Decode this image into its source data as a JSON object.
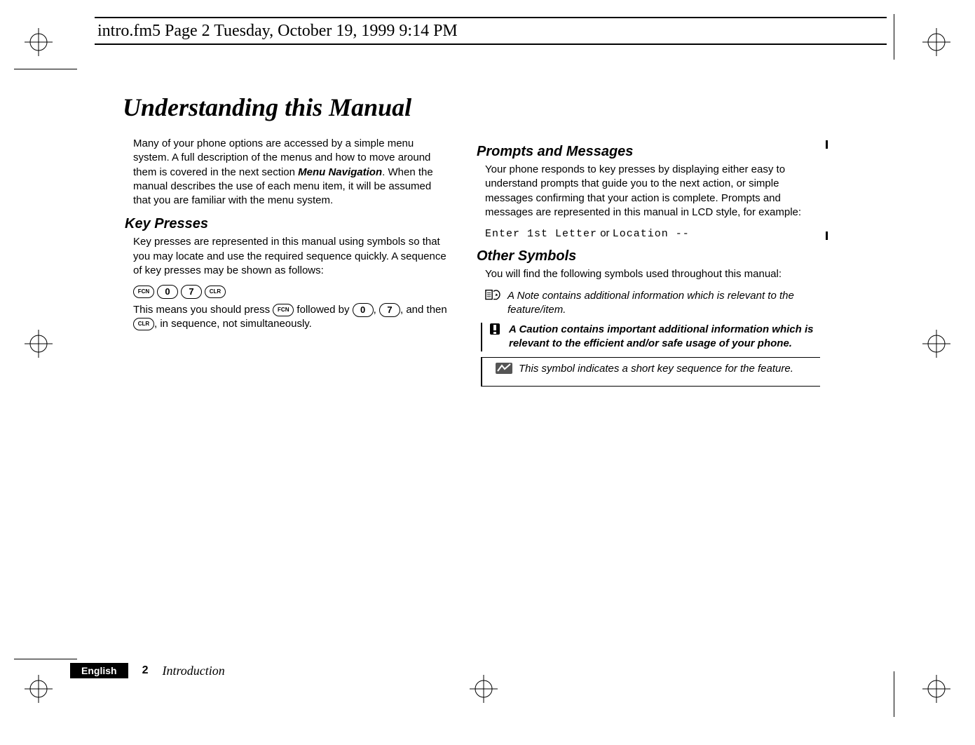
{
  "header": {
    "text": "intro.fm5  Page 2  Tuesday, October 19, 1999  9:14 PM"
  },
  "title": "Understanding this Manual",
  "left": {
    "intro_para": "Many of your phone options are accessed by a simple menu system. A full description of the menus and how to move around them is covered in the next section ",
    "intro_emph": "Menu Navigation",
    "intro_tail": ". When the manual describes the use of each menu item, it will be assumed that you are familiar with the menu system.",
    "key_presses_heading": "Key Presses",
    "kp_para1": "Key presses are represented in this manual using symbols so that you may locate and use the required sequence quickly. A sequence of key presses may be shown as follows:",
    "keys": [
      "FCN",
      "0",
      "7",
      "CLR"
    ],
    "kp_para2_a": "This means you should press ",
    "kp_para2_b": " followed by ",
    "kp_para2_c": ", ",
    "kp_para2_d": ", and then ",
    "kp_para2_e": ", in sequence, not simultaneously."
  },
  "right": {
    "prompts_heading": "Prompts and Messages",
    "prompts_para": "Your phone responds to key presses by displaying either easy to understand prompts that guide you to the next action, or simple messages confirming that your action is complete. Prompts and messages are represented in this manual in LCD style, for example:",
    "lcd1": "Enter 1st Letter",
    "or_label": " or ",
    "lcd2": "Location --",
    "other_heading": "Other Symbols",
    "other_para": "You will find the following symbols used throughout this manual:",
    "note_text": "A Note contains additional information which is relevant to the feature/item.",
    "caution_text": "A Caution contains important additional information which is relevant to the efficient and/or safe usage of your phone.",
    "short_text": "This symbol indicates a short key sequence for the feature."
  },
  "footer": {
    "language": "English",
    "page_number": "2",
    "section": "Introduction"
  }
}
